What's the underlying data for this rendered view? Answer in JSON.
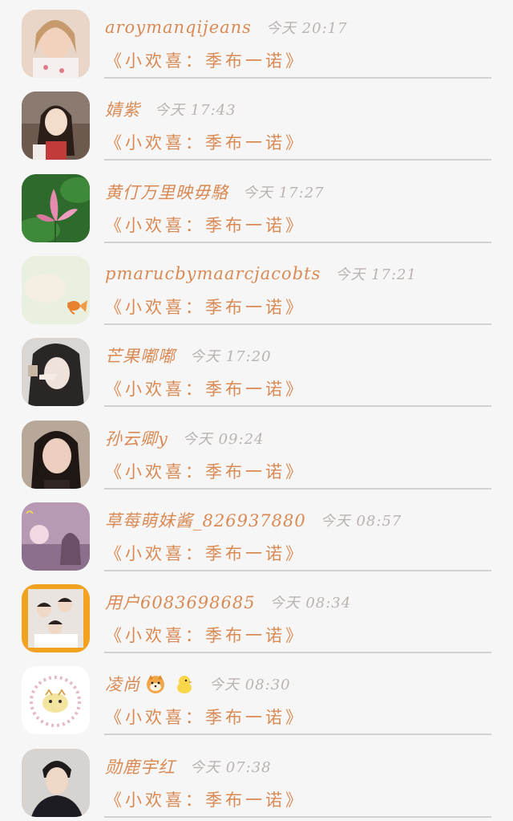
{
  "colors": {
    "background": "#f7f6f6",
    "name_text": "#d98a54",
    "time_text": "#b9b3b0",
    "message_text": "#d98a54",
    "divider": "#d4d2d1"
  },
  "messages": [
    {
      "name": "aroymanqijeans",
      "time": "今天 20:17",
      "message": "《小欢喜：季布一诺》",
      "avatar_icon": "avatar-woman-selfie"
    },
    {
      "name": "婧紫",
      "time": "今天 17:43",
      "message": "《小欢喜：季布一诺》",
      "avatar_icon": "avatar-girl-longhair"
    },
    {
      "name": "黄仃万里映毋駱",
      "time": "今天 17:27",
      "message": "《小欢喜：季布一诺》",
      "avatar_icon": "avatar-lotus-flower"
    },
    {
      "name": "pmarucbymaarcjacobts",
      "time": "今天 17:21",
      "message": "《小欢喜：季布一诺》",
      "avatar_icon": "avatar-goldfish"
    },
    {
      "name": "芒果嘟嘟",
      "time": "今天 17:20",
      "message": "《小欢喜：季布一诺》",
      "avatar_icon": "avatar-girl-peace-sign"
    },
    {
      "name": "孙云卿y",
      "time": "今天 09:24",
      "message": "《小欢喜：季布一诺》",
      "avatar_icon": "avatar-girl-portrait"
    },
    {
      "name": "草莓萌妹酱_826937880",
      "time": "今天 08:57",
      "message": "《小欢喜：季布一诺》",
      "avatar_icon": "avatar-pink-sunset"
    },
    {
      "name": "用户6083698685",
      "time": "今天 08:34",
      "message": "《小欢喜：季布一诺》",
      "avatar_icon": "avatar-group-photo"
    },
    {
      "name": "凌尚",
      "time": "今天 08:30",
      "message": "《小欢喜：季布一诺》",
      "avatar_icon": "avatar-tiger-cartoon",
      "emojis": [
        "shiba-dog-emoji",
        "chick-emoji"
      ]
    },
    {
      "name": "勋鹿宇红",
      "time": "今天 07:38",
      "message": "《小欢喜：季布一诺》",
      "avatar_icon": "avatar-man-dark-coat"
    }
  ]
}
